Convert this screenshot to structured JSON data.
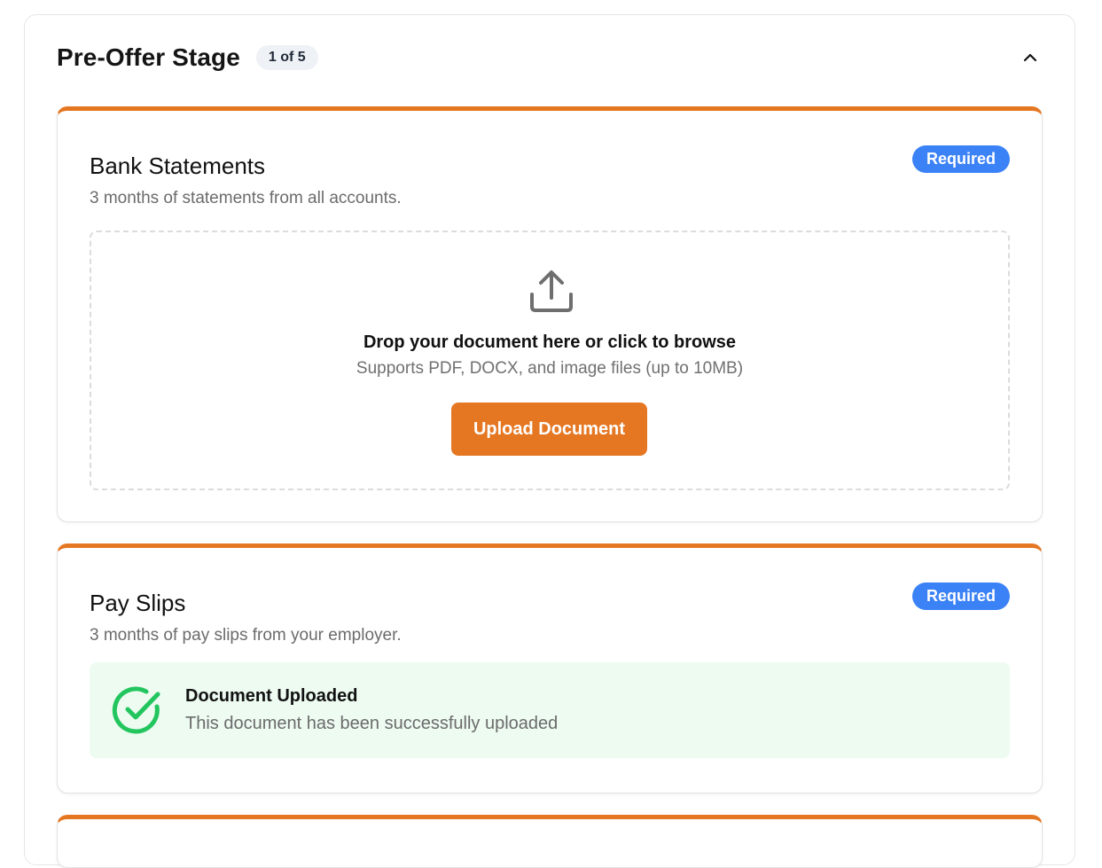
{
  "stage": {
    "title": "Pre-Offer Stage",
    "progress": "1 of 5",
    "collapse_icon": "chevron-up-icon"
  },
  "documents": [
    {
      "title": "Bank Statements",
      "description": "3 months of statements from all accounts.",
      "badge": "Required",
      "status": "pending",
      "dropzone": {
        "icon": "upload-icon",
        "title": "Drop your document here or click to browse",
        "subtitle": "Supports PDF, DOCX, and image files (up to 10MB)",
        "button_label": "Upload Document"
      }
    },
    {
      "title": "Pay Slips",
      "description": "3 months of pay slips from your employer.",
      "badge": "Required",
      "status": "uploaded",
      "success": {
        "icon": "check-circle-icon",
        "title": "Document Uploaded",
        "subtitle": "This document has been successfully uploaded"
      }
    }
  ],
  "colors": {
    "accent": "#e57723",
    "required_badge": "#3b82f6",
    "success": "#22c55e",
    "success_bg": "#edfbf1"
  }
}
